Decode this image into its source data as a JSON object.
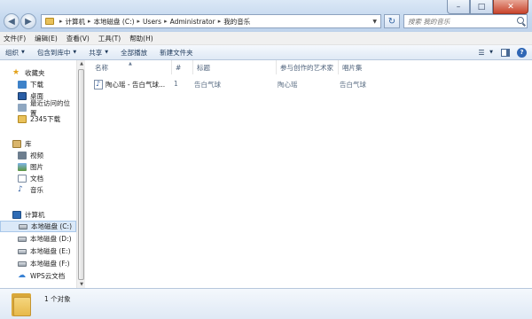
{
  "window": {
    "min_icon": "minimize-icon",
    "max_icon": "maximize-icon",
    "close_icon": "close-icon"
  },
  "address": {
    "crumbs": [
      "计算机",
      "本地磁盘 (C:)",
      "Users",
      "Administrator",
      "我的音乐"
    ]
  },
  "search": {
    "placeholder": "搜索 我的音乐"
  },
  "menu": [
    "文件(F)",
    "编辑(E)",
    "查看(V)",
    "工具(T)",
    "帮助(H)"
  ],
  "toolbar": {
    "organize": "组织",
    "include_in_library": "包含到库中",
    "share": "共享",
    "play_all": "全部播放",
    "new_folder": "新建文件夹"
  },
  "nav": {
    "favorites": "收藏夹",
    "downloads": "下载",
    "desktop": "桌面",
    "recent": "最近访问的位置",
    "downloads_2345": "2345下载",
    "libraries": "库",
    "videos": "视频",
    "pictures": "图片",
    "documents": "文档",
    "music": "音乐",
    "computer": "计算机",
    "drive_c": "本地磁盘 (C:)",
    "drive_d": "本地磁盘 (D:)",
    "drive_e": "本地磁盘 (E:)",
    "drive_f": "本地磁盘 (F:)",
    "wps_cloud": "WPS云文档"
  },
  "columns": {
    "name": "名称",
    "number": "#",
    "title": "标题",
    "artist": "参与创作的艺术家",
    "album": "唱片集"
  },
  "files": [
    {
      "name": "陶心瑶 - 告白气球...",
      "number": "1",
      "title": "告白气球",
      "artist": "陶心瑶",
      "album": "告白气球"
    }
  ],
  "status": {
    "count": "1 个对象"
  },
  "colors": {
    "selection": "#dbe9f8",
    "toolbar_text": "#1e395b"
  }
}
